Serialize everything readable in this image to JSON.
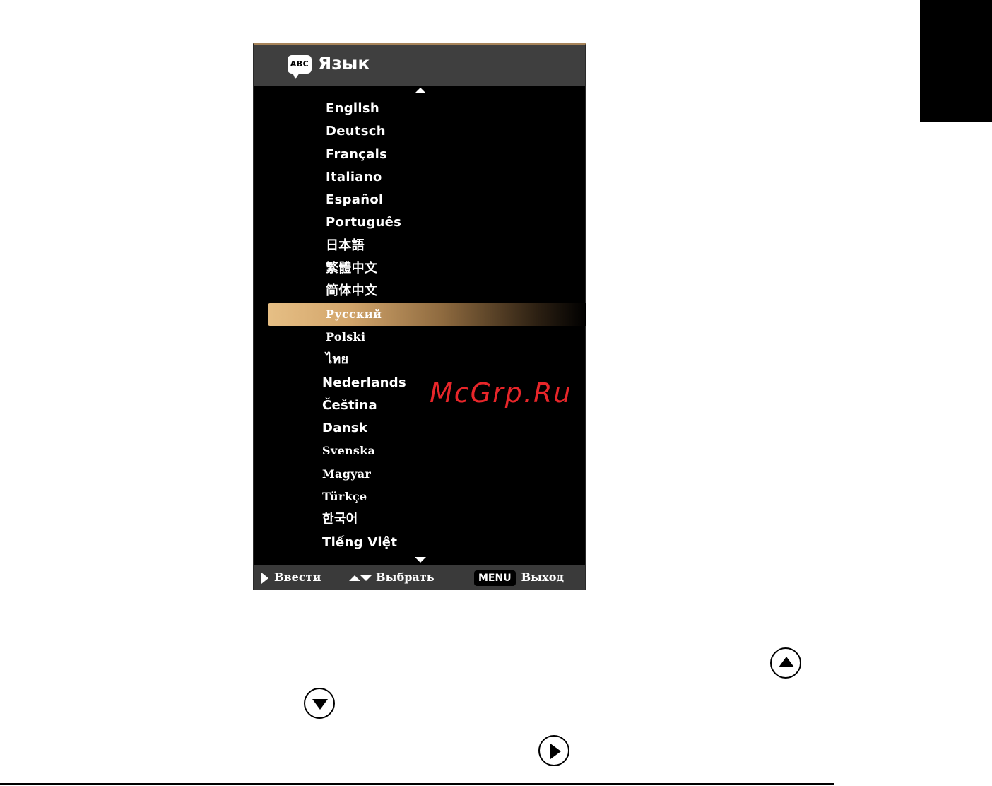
{
  "header": {
    "icon_text": "ABC",
    "title": "Язык"
  },
  "languages": [
    "English",
    "Deutsch",
    "Français",
    "Italiano",
    "Español",
    "Português",
    "日本語",
    "繁體中文",
    "简体中文",
    "Русский",
    "Polski",
    "ไทย",
    "Nederlands",
    "Čeština",
    "Dansk",
    "Svenska",
    "Magyar",
    "Türkçe",
    "한국어",
    "Tiếng Việt"
  ],
  "selected_language": "Русский",
  "footer": {
    "enter_label": "Ввести",
    "select_label": "Выбрать",
    "menu_key": "MENU",
    "exit_label": "Выход"
  },
  "watermark": "McGrp.Ru",
  "icons": {
    "scroll_up": "triangle-up-icon",
    "scroll_down": "triangle-down-icon",
    "remote_up": "circle-up-button-icon",
    "remote_down": "circle-down-button-icon",
    "remote_right": "circle-right-button-icon"
  },
  "colors": {
    "highlight": "#d3a66c",
    "header_bg": "#3f3f3f",
    "watermark": "#e8262a"
  }
}
